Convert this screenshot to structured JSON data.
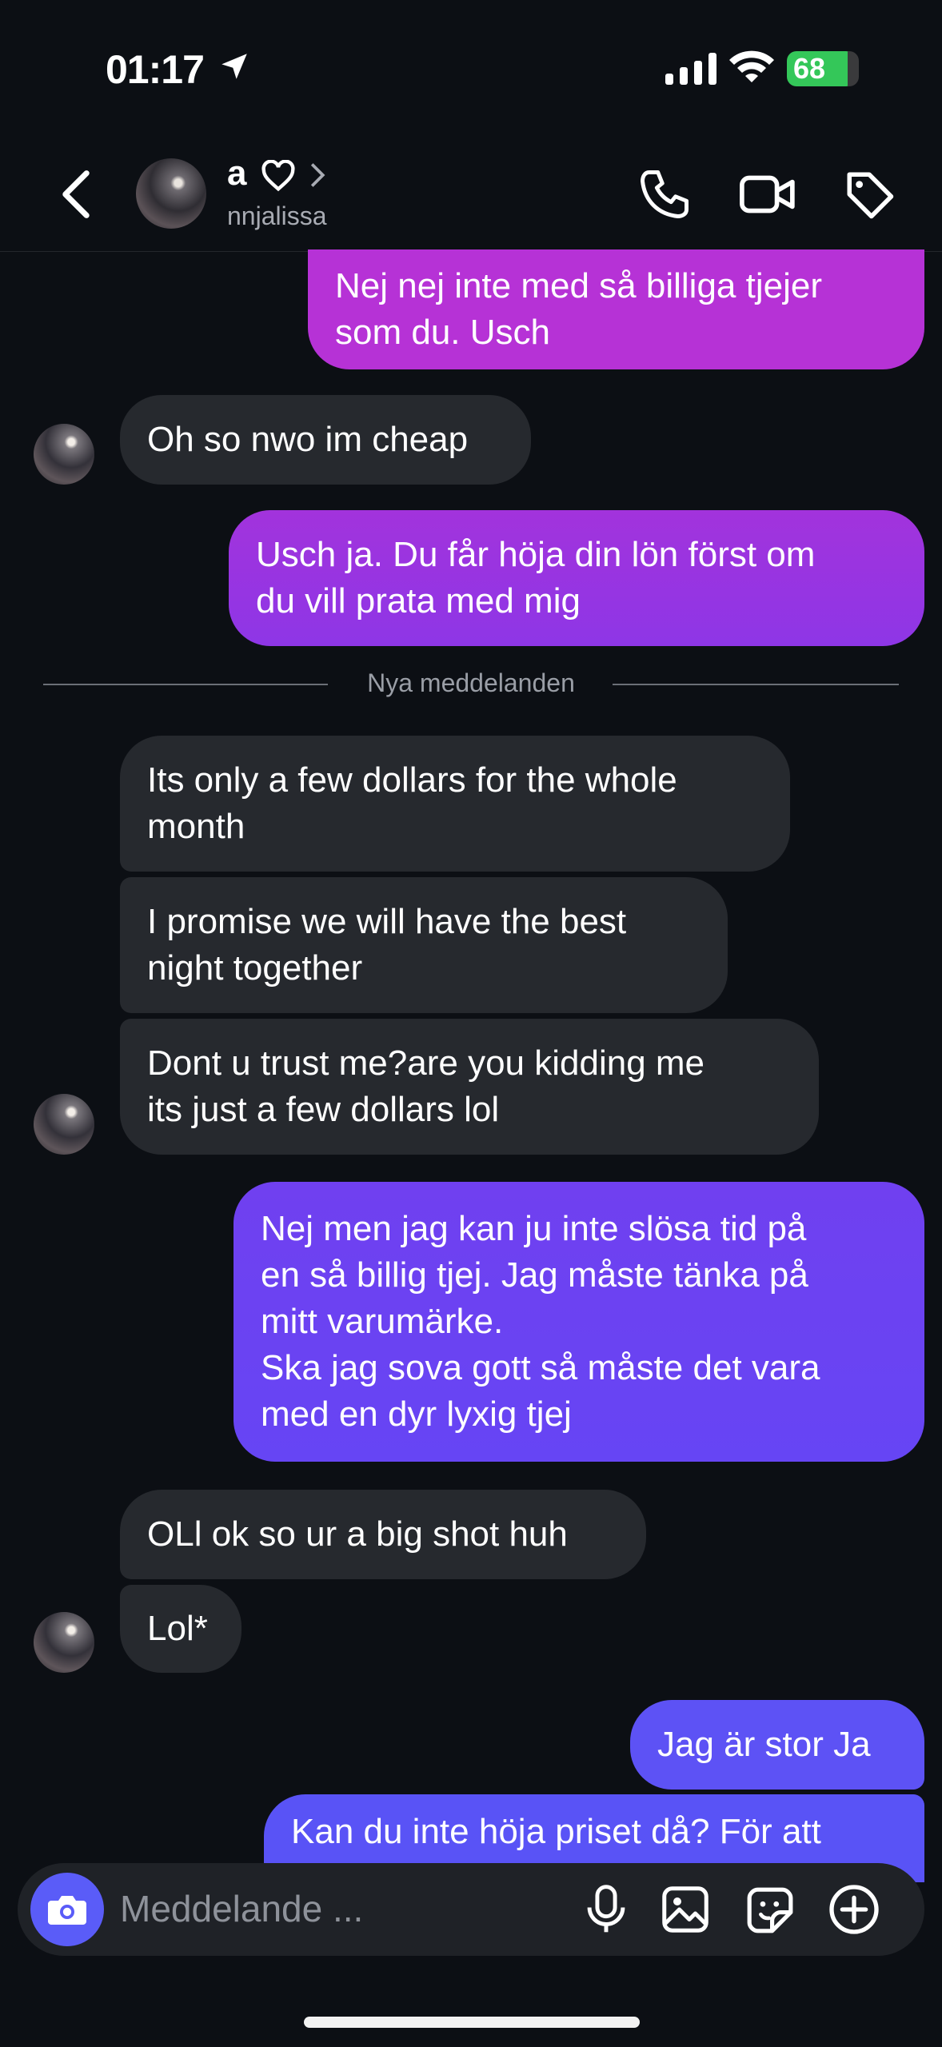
{
  "status_bar": {
    "time": "01:17",
    "battery": "68"
  },
  "header": {
    "name": "a",
    "username": "nnjalissa"
  },
  "divider": {
    "text": "Nya meddelanden"
  },
  "messages": [
    {
      "dir": "out",
      "lines": [
        "Nej nej inte med så billiga tjejer",
        "som du. Usch"
      ]
    },
    {
      "dir": "in",
      "lines": [
        "Oh so nwo im cheap"
      ]
    },
    {
      "dir": "out",
      "lines": [
        "Usch ja. Du får höja din lön först om",
        "du vill prata med mig"
      ]
    },
    {
      "dir": "in",
      "lines": [
        "Its only a few dollars for the whole",
        "month"
      ]
    },
    {
      "dir": "in",
      "lines": [
        "I promise we will have the best",
        "night together"
      ]
    },
    {
      "dir": "in",
      "lines": [
        "Dont u trust me?are you kidding me",
        "its just a few dollars lol"
      ]
    },
    {
      "dir": "out",
      "lines": [
        "Nej men jag kan ju inte slösa tid på",
        "en så billig tjej. Jag måste tänka på",
        "mitt varumärke.",
        "Ska jag sova gott så måste det vara",
        "med en dyr lyxig tjej"
      ]
    },
    {
      "dir": "in",
      "lines": [
        "OLl ok so ur a big shot huh"
      ]
    },
    {
      "dir": "in",
      "lines": [
        "Lol*"
      ]
    },
    {
      "dir": "out",
      "lines": [
        "Jag är stor Ja"
      ]
    },
    {
      "dir": "out",
      "lines": [
        "Kan du inte höja priset då? För att"
      ]
    }
  ],
  "composer": {
    "placeholder": "Meddelande ..."
  },
  "colors": {
    "background": "#0c0f14",
    "incoming_bubble": "#26292e",
    "outgoing_top": "#b832d8",
    "outgoing_mid": "#7a3cf0",
    "outgoing_bottom": "#5a55f6",
    "camera_button": "#5a5cf8"
  }
}
